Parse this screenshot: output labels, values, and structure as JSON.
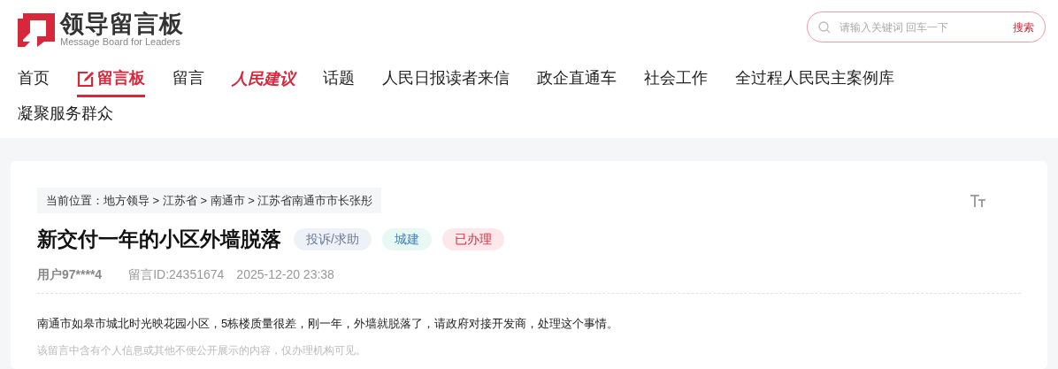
{
  "logo": {
    "title": "领导留言板",
    "subtitle": "Message Board for Leaders"
  },
  "search": {
    "placeholder": "请输入关键词 回车一下",
    "button": "搜索"
  },
  "nav": [
    {
      "label": "首页",
      "kind": "text",
      "selected": false
    },
    {
      "label": "留言板",
      "kind": "pen",
      "selected": true
    },
    {
      "label": "留言",
      "kind": "text",
      "selected": false
    },
    {
      "label": "人民建议",
      "kind": "brand",
      "selected": false
    },
    {
      "label": "话题",
      "kind": "text",
      "selected": false
    },
    {
      "label": "人民日报读者来信",
      "kind": "text",
      "selected": false
    },
    {
      "label": "政企直通车",
      "kind": "text",
      "selected": false
    },
    {
      "label": "社会工作",
      "kind": "text",
      "selected": false
    },
    {
      "label": "全过程人民民主案例库",
      "kind": "text",
      "selected": false
    },
    {
      "label": "凝聚服务群众",
      "kind": "text",
      "selected": false
    }
  ],
  "breadcrumb": "当前位置：地方领导 > 江苏省 > 南通市 > 江苏省南通市市长张彤",
  "message": {
    "title": "新交付一年的小区外墙脱落",
    "tags": [
      {
        "label": "投诉/求助",
        "kind": "type"
      },
      {
        "label": "城建",
        "kind": "field"
      },
      {
        "label": "已办理",
        "kind": "status"
      }
    ],
    "user": "用户97****4",
    "id": "留言ID:24351674",
    "time": "2025-12-20 23:38",
    "body": "南通市如皋市城北时光映花园小区，5栋楼质量很差，刚一年，外墙就脱落了，请政府对接开发商，处理这个事情。",
    "notice": "该留言中含有个人信息或其他不便公开展示的内容，仅办理机构可见。"
  }
}
